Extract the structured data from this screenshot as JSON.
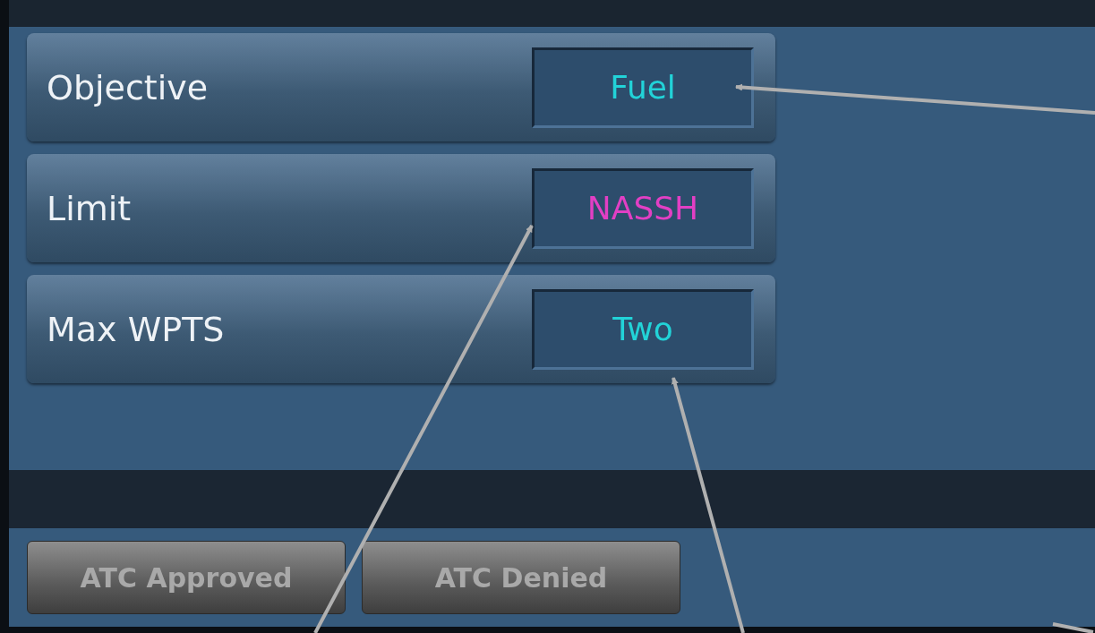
{
  "settings": [
    {
      "label": "Objective",
      "value": "Fuel",
      "color": "#22d3d8"
    },
    {
      "label": "Limit",
      "value": "NASSH",
      "color": "#e23fc4"
    },
    {
      "label": "Max WPTS",
      "value": "Two",
      "color": "#22d3d8"
    }
  ],
  "buttons": [
    {
      "label": "ATC Approved",
      "disabled": true
    },
    {
      "label": "ATC Denied",
      "disabled": true
    }
  ]
}
